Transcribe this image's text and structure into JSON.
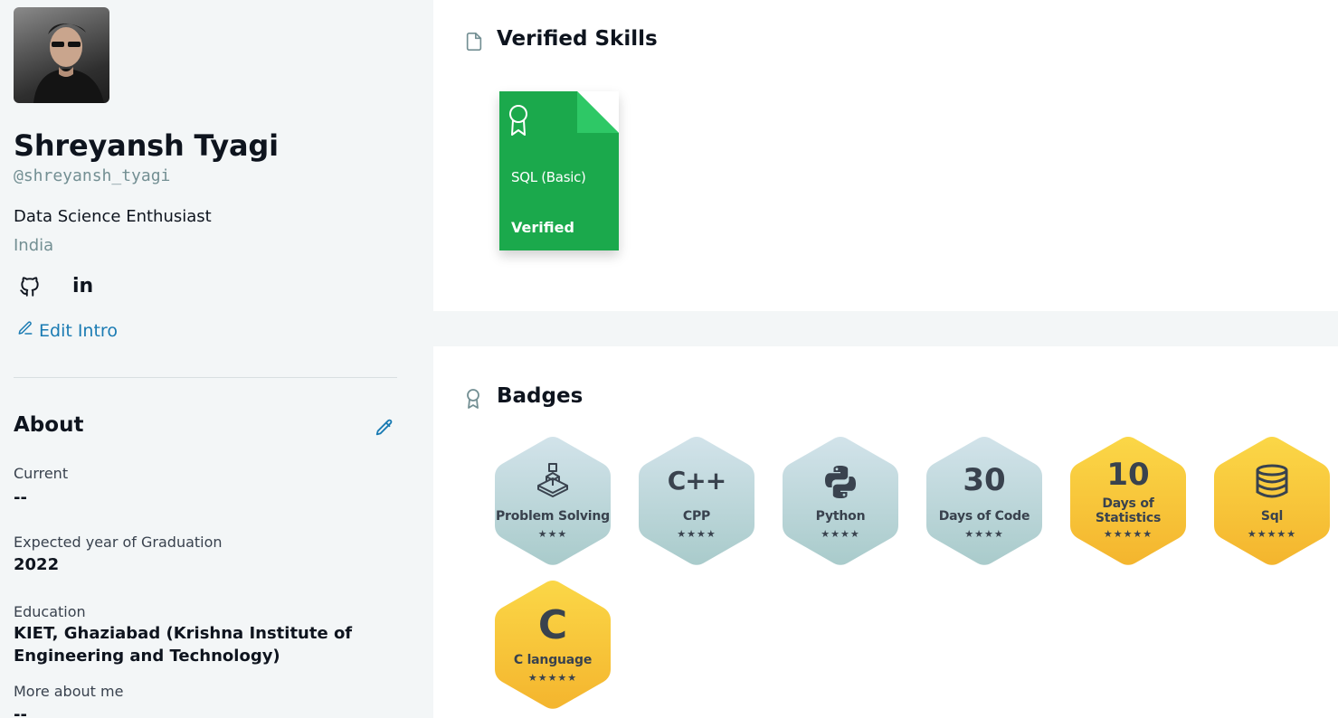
{
  "profile": {
    "name": "Shreyansh Tyagi",
    "handle": "@shreyansh_tyagi",
    "headline": "Data Science Enthusiast",
    "country": "India",
    "social": [
      "github-icon",
      "linkedin-icon"
    ],
    "linkedin_text": "in",
    "edit_intro_label": "Edit Intro"
  },
  "about": {
    "title": "About",
    "current_label": "Current",
    "current_value": "--",
    "graduation_label": "Expected year of Graduation",
    "graduation_value": "2022",
    "education_label": "Education",
    "education_value": "KIET, Ghaziabad (Krishna Institute of Engineering and Technology)",
    "more_label": "More about me",
    "more_value": "--"
  },
  "skills": {
    "title": "Verified Skills",
    "cards": [
      {
        "name": "SQL (Basic)",
        "status": "Verified",
        "color": "#1ba94c"
      }
    ]
  },
  "badges": {
    "title": "Badges",
    "items": [
      {
        "label": "Problem Solving",
        "stars": "★★★",
        "tier": "silver",
        "icon": "blocks-icon"
      },
      {
        "label": "CPP",
        "stars": "★★★★",
        "tier": "silver",
        "icon_text": "C++"
      },
      {
        "label": "Python",
        "stars": "★★★★",
        "tier": "silver",
        "icon": "python-icon"
      },
      {
        "label": "Days of Code",
        "stars": "★★★★",
        "tier": "silver",
        "icon_text": "30"
      },
      {
        "label": "Days of Statistics",
        "label_line1": "Days of",
        "label_line2": "Statistics",
        "stars": "★★★★★",
        "tier": "gold",
        "icon_text": "10"
      },
      {
        "label": "Sql",
        "stars": "★★★★★",
        "tier": "gold",
        "icon": "database-icon"
      },
      {
        "label": "C language",
        "stars": "★★★★★",
        "tier": "gold",
        "icon_text": "C"
      }
    ]
  },
  "colors": {
    "accent_link": "#1a7bb3",
    "skill_green": "#1ba94c",
    "silver_top": "#d2e3ea",
    "silver_bottom": "#a9cbcb",
    "gold_top": "#fbd747",
    "gold_bottom": "#f4b52e"
  }
}
